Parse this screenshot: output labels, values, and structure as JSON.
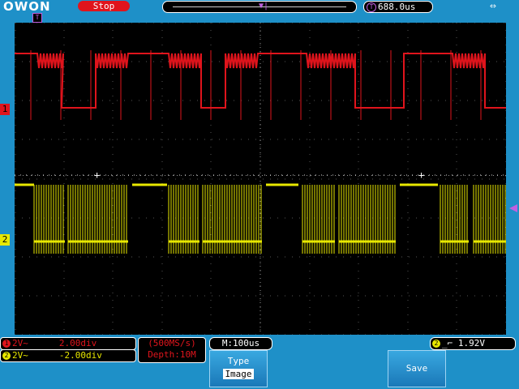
{
  "brand": "OWON",
  "status": "Stop",
  "trigger_delay": "688.0us",
  "trigger_marker": "T",
  "channels": [
    {
      "id": "1",
      "coupling": "2V~",
      "scale": "2.00div",
      "color": "#e0141c"
    },
    {
      "id": "2",
      "coupling": "2V~",
      "scale": "-2.00div",
      "color": "#e8e800"
    }
  ],
  "acquisition": {
    "rate": "(500MS/s)",
    "depth": "Depth:10M"
  },
  "timebase": "M:100us",
  "trigger": {
    "channel": "2",
    "level": "1.92V"
  },
  "menu": {
    "type_label": "Type",
    "type_value": "Image",
    "save_label": "Save"
  },
  "colors": {
    "bezel": "#1e90c8",
    "ch1": "#e0141c",
    "ch2": "#e8e800",
    "trigger": "#c060e0"
  }
}
